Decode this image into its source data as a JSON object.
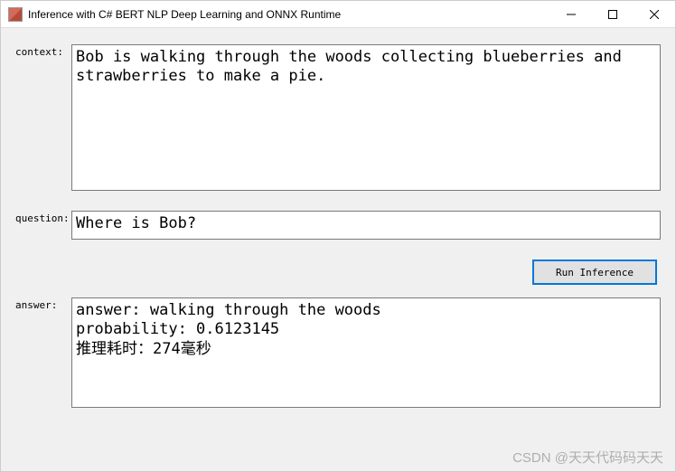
{
  "window": {
    "title": "Inference with C# BERT NLP Deep Learning and ONNX Runtime"
  },
  "labels": {
    "context": "context:",
    "question": "question:",
    "answer": "answer:"
  },
  "fields": {
    "context": "Bob is walking through the woods collecting blueberries and strawberries to make a pie.",
    "question": "Where is Bob?",
    "answer": "answer: walking through the woods\nprobability: 0.6123145\n推理耗时：274毫秒"
  },
  "buttons": {
    "run_inference": "Run Inference"
  },
  "watermark": "CSDN @天天代码码天天"
}
